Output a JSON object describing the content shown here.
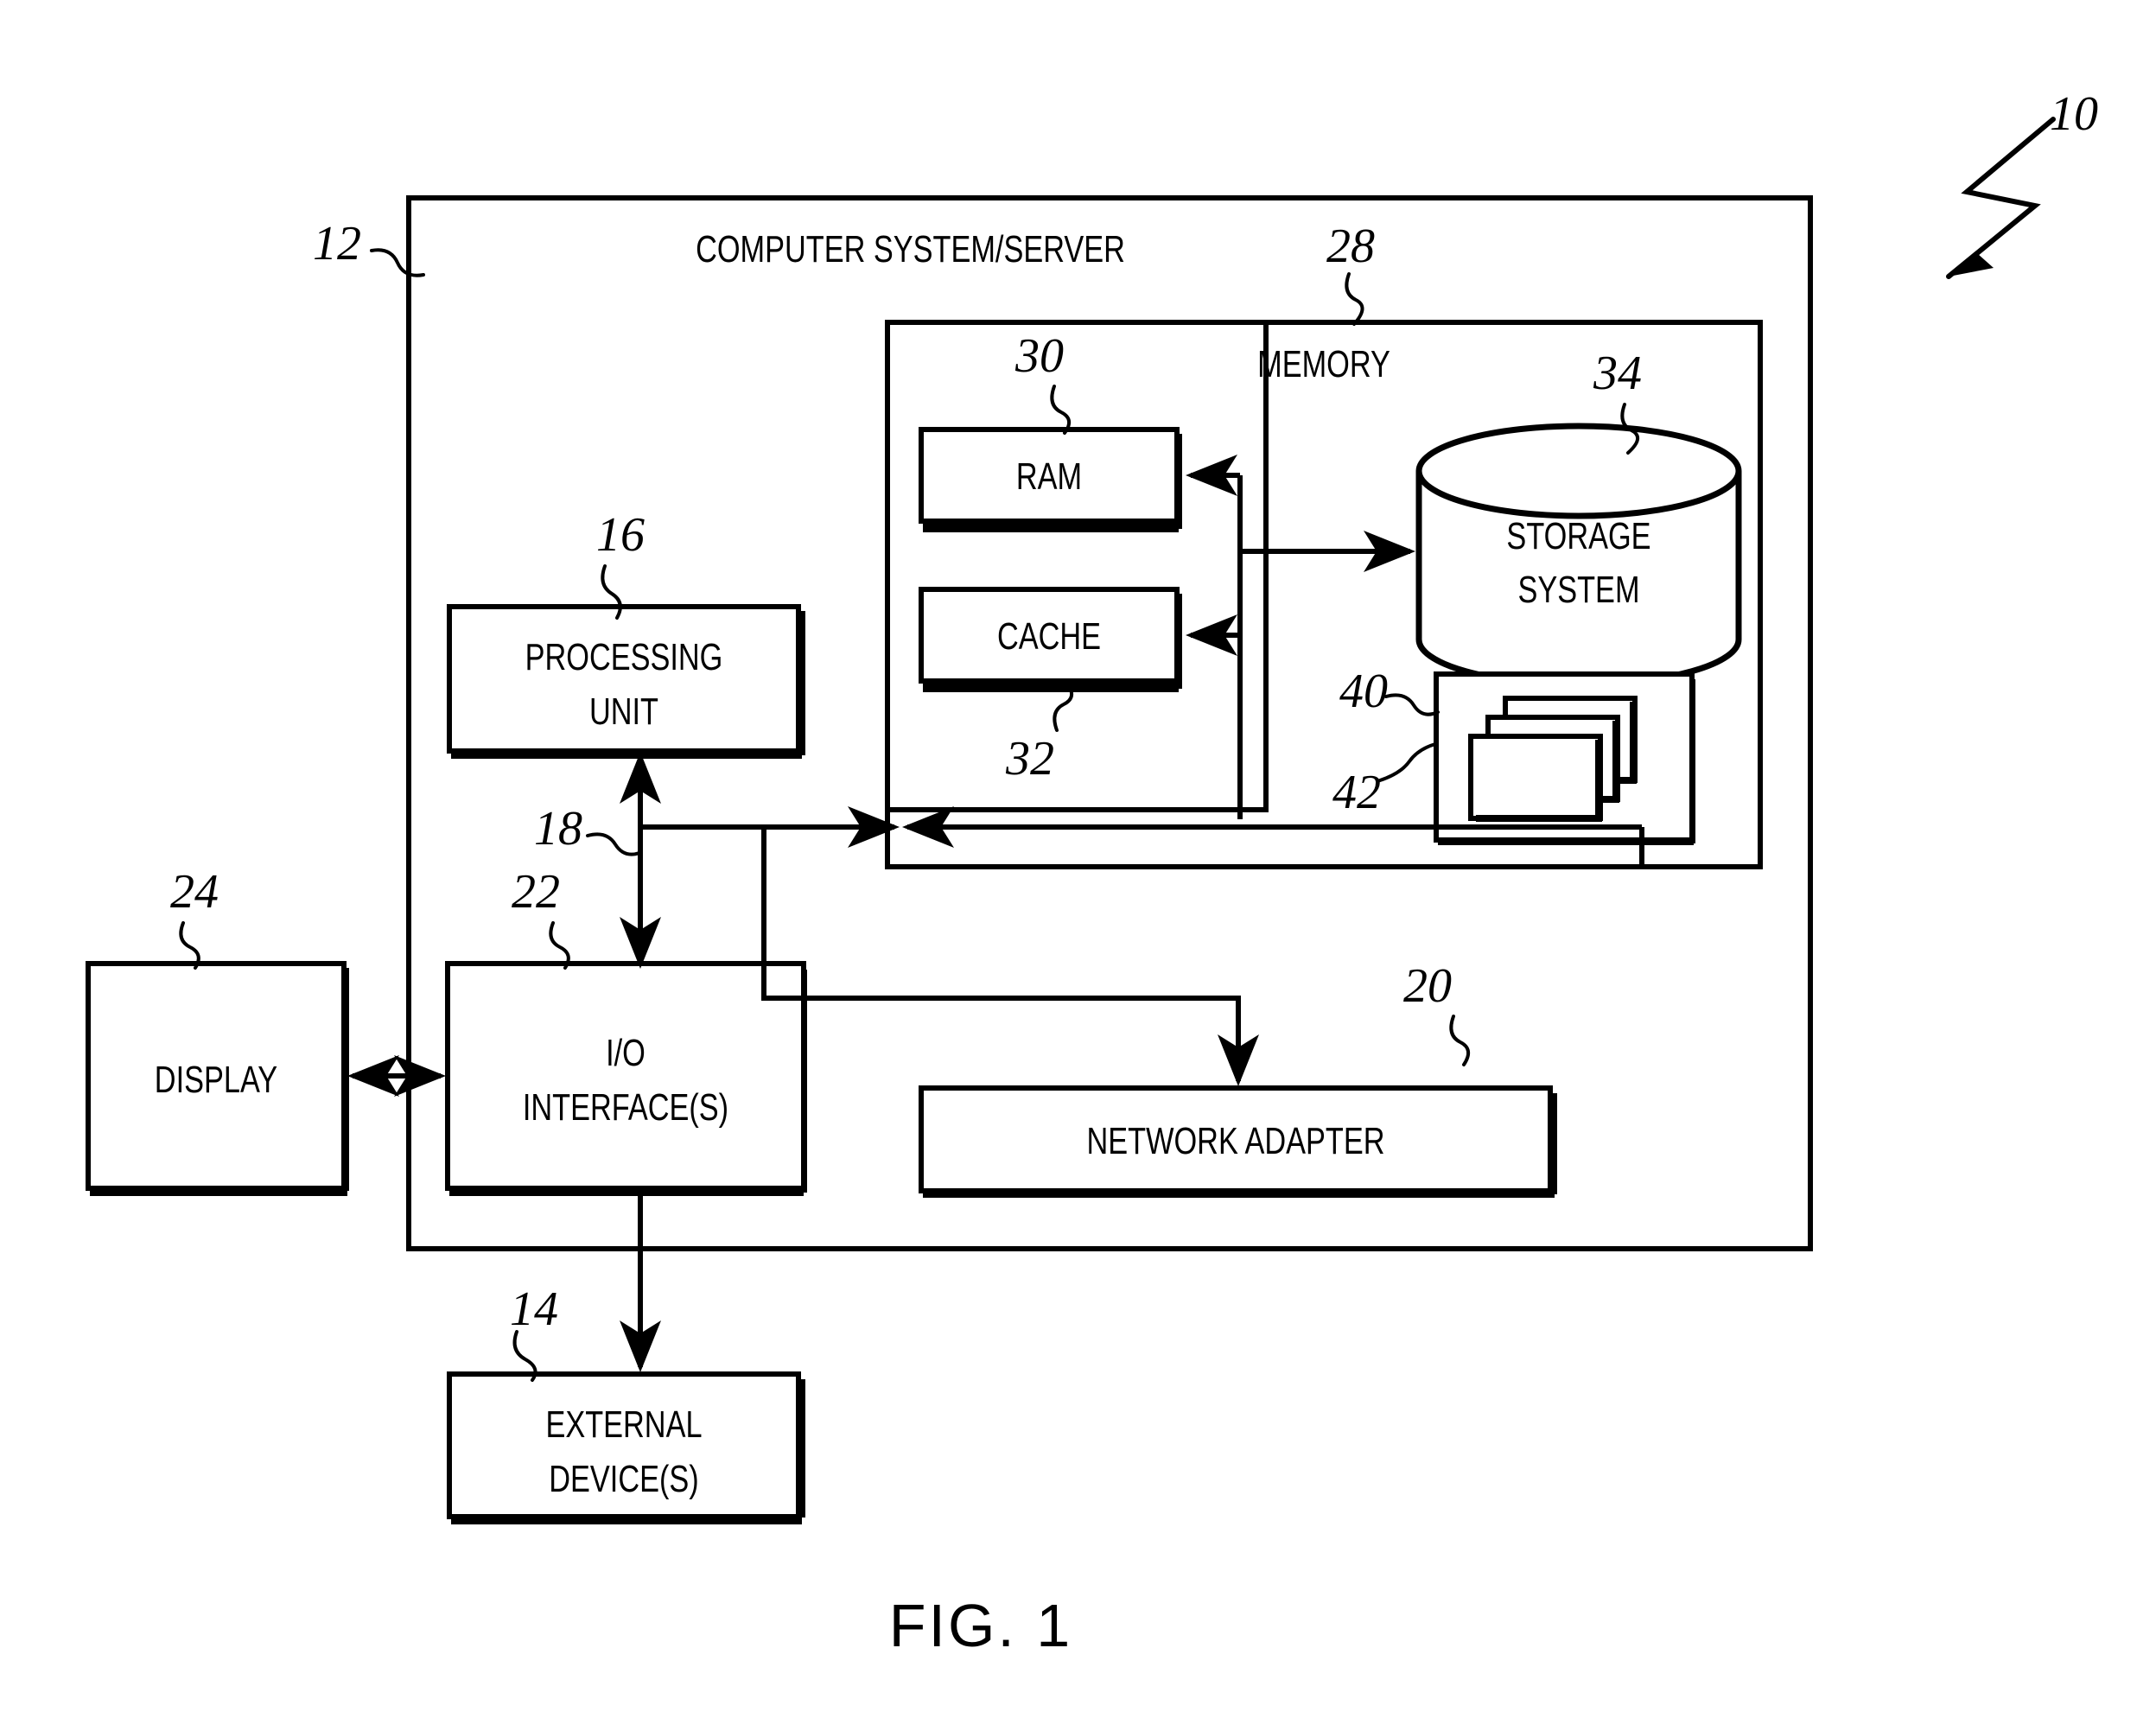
{
  "figure": {
    "caption": "FIG. 1",
    "system_ref": "10"
  },
  "blocks": [
    {
      "id": "computer_system",
      "label": "COMPUTER SYSTEM/SERVER",
      "ref": "12"
    },
    {
      "id": "memory",
      "label": "MEMORY",
      "ref": "28"
    },
    {
      "id": "ram",
      "label": "RAM",
      "ref": "30"
    },
    {
      "id": "cache",
      "label": "CACHE",
      "ref": "32"
    },
    {
      "id": "storage_system",
      "label_line1": "STORAGE",
      "label_line2": "SYSTEM",
      "ref": "34"
    },
    {
      "id": "program_modules_container",
      "label": "",
      "ref": "40"
    },
    {
      "id": "program_modules",
      "label": "",
      "ref": "42"
    },
    {
      "id": "processing_unit",
      "label_line1": "PROCESSING",
      "label_line2": "UNIT",
      "ref": "16"
    },
    {
      "id": "bus",
      "label": "",
      "ref": "18"
    },
    {
      "id": "io_interface",
      "label_line1": "I/O",
      "label_line2": "INTERFACE(S)",
      "ref": "22"
    },
    {
      "id": "network_adapter",
      "label": "NETWORK ADAPTER",
      "ref": "20"
    },
    {
      "id": "display",
      "label": "DISPLAY",
      "ref": "24"
    },
    {
      "id": "external_devices",
      "label_line1": "EXTERNAL",
      "label_line2": "DEVICE(S)",
      "ref": "14"
    }
  ],
  "labels": {
    "computer_system": "COMPUTER SYSTEM/SERVER",
    "memory": "MEMORY",
    "ram": "RAM",
    "cache": "CACHE",
    "storage_1": "STORAGE",
    "storage_2": "SYSTEM",
    "processing_1": "PROCESSING",
    "processing_2": "UNIT",
    "io_1": "I/O",
    "io_2": "INTERFACE(S)",
    "network_adapter": "NETWORK ADAPTER",
    "display": "DISPLAY",
    "external_1": "EXTERNAL",
    "external_2": "DEVICE(S)",
    "caption": "FIG. 1"
  },
  "refs": {
    "r10": "10",
    "r12": "12",
    "r14": "14",
    "r16": "16",
    "r18": "18",
    "r20": "20",
    "r22": "22",
    "r24": "24",
    "r28": "28",
    "r30": "30",
    "r32": "32",
    "r34": "34",
    "r40": "40",
    "r42": "42"
  },
  "colors": {
    "ink": "#000000",
    "paper": "#ffffff"
  }
}
